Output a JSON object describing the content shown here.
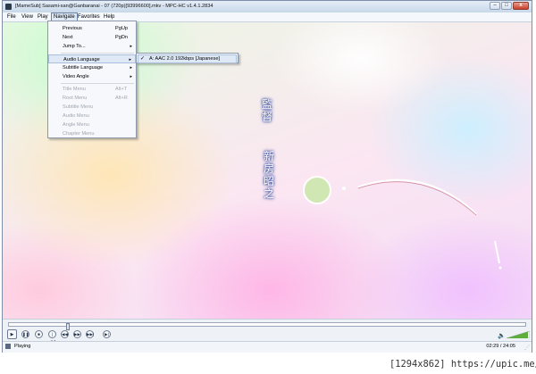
{
  "window": {
    "title": "[MameSub] Sasami-san@Ganbaranai - 07 (720p)[93996600].mkv - MPC-HC v1.4.1.2834",
    "min_glyph": "–",
    "max_glyph": "□",
    "close_glyph": "x"
  },
  "menubar": {
    "items": [
      {
        "label": "File"
      },
      {
        "label": "View"
      },
      {
        "label": "Play"
      },
      {
        "label": "Navigate"
      },
      {
        "label": "Favorites"
      },
      {
        "label": "Help"
      }
    ],
    "active": "Navigate"
  },
  "navigate_menu": {
    "items": [
      {
        "label": "Previous",
        "shortcut": "PgUp"
      },
      {
        "label": "Next",
        "shortcut": "PgDn"
      },
      {
        "label": "Jump To...",
        "submenu_arrow": "▸"
      },
      {
        "label": "Audio Language",
        "submenu_arrow": "▸",
        "highlighted": true
      },
      {
        "label": "Subtitle Language",
        "submenu_arrow": "▸"
      },
      {
        "label": "Video Angle",
        "submenu_arrow": "▸"
      },
      {
        "label": "Title Menu",
        "shortcut": "Alt+T",
        "disabled": true
      },
      {
        "label": "Root Menu",
        "shortcut": "Alt+R",
        "disabled": true
      },
      {
        "label": "Subtitle Menu",
        "disabled": true
      },
      {
        "label": "Audio Menu",
        "disabled": true
      },
      {
        "label": "Angle Menu",
        "disabled": true
      },
      {
        "label": "Chapter Menu",
        "disabled": true
      }
    ]
  },
  "audio_submenu": {
    "check": "✓",
    "item": "A: AAC 2.0 192kbps [Japanese]"
  },
  "video_overlay": {
    "col1": "監\n督",
    "col2": "新\n房\n昭\n之"
  },
  "controls": {
    "buttons": [
      "▶",
      "❚❚",
      "■",
      "|◀◀",
      "◀◀",
      "▶▶",
      "▶▶|",
      "▶|"
    ],
    "volume_icon": "🔈"
  },
  "status": {
    "state": "Playing",
    "time": "02:29 / 24:05"
  },
  "watermark": "[1294x862] https://upic.me/",
  "colors": {
    "menu_highlight": "#dfe9f6",
    "disabled_text": "#a0a6b0"
  }
}
